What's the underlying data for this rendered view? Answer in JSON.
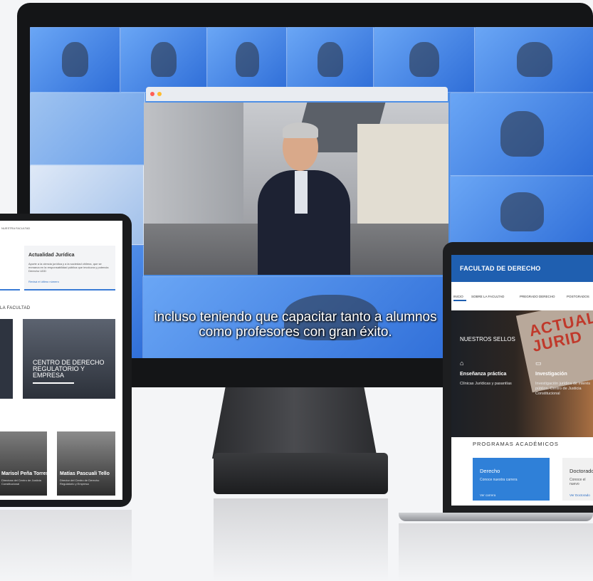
{
  "monitor": {
    "subtitle_line1": "incluso teniendo que capacitar tanto a alumnos",
    "subtitle_line2": "como profesores con gran éxito."
  },
  "tablet": {
    "breadcrumb": "NUESTRA FACULTAD",
    "card_title": "Actualidad Jurídica",
    "card_text": "Aporte a la ciencia jurídica y a la sociedad chilena, que se enmarca en la responsabilidad pública que involucra y potencia Derecho UDD",
    "card_link": "Revisá el último número",
    "section_label": "LA FACULTAD",
    "photo_caption": "CENTRO DE DERECHO REGULATORIO Y EMPRESA",
    "person1_name": "Marisol Peña Torres",
    "person1_role": "Directora del Centro de Justicia Constitucional",
    "person2_name": "Matías Pascuali Tello",
    "person2_role": "Director del Centro de Derecho Regulatorio y Empresa"
  },
  "laptop": {
    "brand": "FACULTAD DE DERECHO",
    "nav": [
      "INICIO",
      "SOBRE LA FACULTAD",
      "PREGRADO DERECHO",
      "POSTGRADOS"
    ],
    "hero_book_text": "ACTUAL JURID",
    "sellos_title": "NUESTROS SELLOS",
    "col1_title": "Enseñanza práctica",
    "col1_text": "Clínicas Jurídicas y pasantías",
    "col2_title": "Investigación",
    "col2_text": "Investigación jurídica de interés público. Centro de Justicia Constitucional",
    "programs_title": "PROGRAMAS ACADÉMICOS",
    "card1_title": "Derecho",
    "card1_text": "Conoce nuestra carrera",
    "card1_link": "Ver carrera",
    "card2_title": "Doctorado",
    "card2_text": "Conoce el nuevo Doctorado",
    "card2_link": "Ver Doctorado"
  },
  "colors": {
    "brand_blue": "#1f5fb0",
    "accent_blue": "#2f80d8"
  }
}
